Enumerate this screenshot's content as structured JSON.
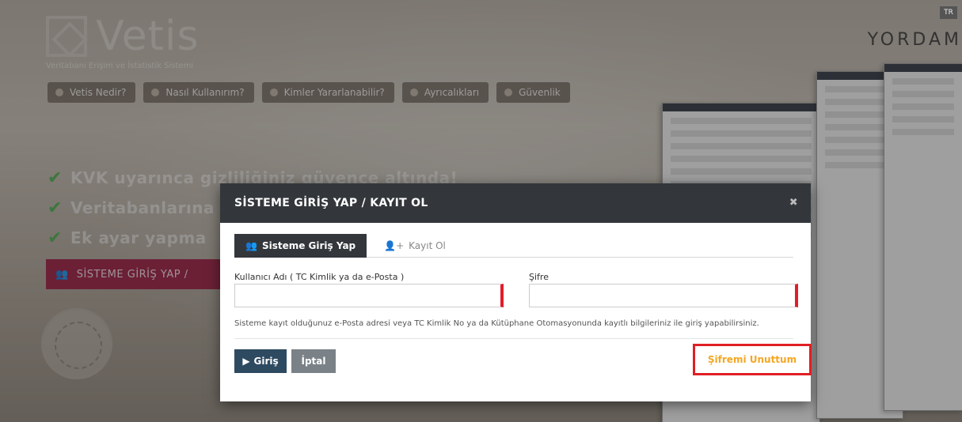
{
  "background": {
    "lang_badge": "TR",
    "logo_text": "Vetis",
    "logo_subtitle": "Veritabanı Erişim ve İstatistik Sistemi",
    "partner_logo": "YORDAM",
    "nav": [
      {
        "label": "Vetis Nedir?"
      },
      {
        "label": "Nasıl Kullanırım?"
      },
      {
        "label": "Kimler Yararlanabilir?"
      },
      {
        "label": "Ayrıcalıkları"
      },
      {
        "label": "Güvenlik"
      }
    ],
    "features": [
      "KVK uyarınca gizliliğiniz güvence altında!",
      "Veritabanlarına",
      "Ek ayar yapma"
    ],
    "login_button": "SİSTEME GİRİŞ YAP /"
  },
  "modal": {
    "title": "SİSTEME GİRİŞ YAP / KAYIT OL",
    "close_icon": "close-icon",
    "tabs": [
      {
        "label": "Sisteme Giriş Yap",
        "icon": "users-icon",
        "active": true
      },
      {
        "label": "Kayıt Ol",
        "icon": "user-plus-icon",
        "active": false
      }
    ],
    "username_label": "Kullanıcı Adı ( TC Kimlik ya da e-Posta )",
    "username_value": "",
    "password_label": "Şifre",
    "password_value": "",
    "help_text": "Sisteme kayıt olduğunuz e-Posta adresi veya TC Kimlik No ya da Kütüphane Otomasyonunda kayıtlı bilgileriniz ile giriş yapabilirsiniz.",
    "login_button": "Giriş",
    "cancel_button": "İptal",
    "forgot_link": "Şifremi Unuttum"
  },
  "colors": {
    "header_bg": "#33373b",
    "login_btn": "#2e4a60",
    "cancel_btn": "#7b8287",
    "required_marker": "#e21d2a",
    "forgot_text": "#f5a623",
    "highlight_border": "#e01f24"
  }
}
